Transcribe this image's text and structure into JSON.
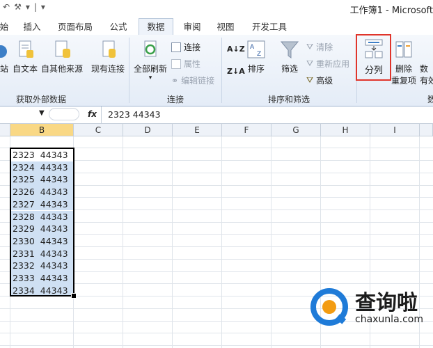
{
  "window": {
    "title": "工作簿1 - Microsoft"
  },
  "tabs": [
    {
      "label": "始"
    },
    {
      "label": "插入"
    },
    {
      "label": "页面布局"
    },
    {
      "label": "公式"
    },
    {
      "label": "数据",
      "active": true
    },
    {
      "label": "审阅"
    },
    {
      "label": "视图"
    },
    {
      "label": "开发工具"
    }
  ],
  "ribbon": {
    "get_external": {
      "web": "站",
      "text": "自文本",
      "other": "自其他来源",
      "existing": "现有连接",
      "group": "获取外部数据"
    },
    "connections": {
      "refresh_all": "全部刷新",
      "connections": "连接",
      "properties": "属性",
      "edit_links": "编辑链接",
      "group": "连接"
    },
    "sort_filter": {
      "sort": "排序",
      "filter": "筛选",
      "clear": "清除",
      "reapply": "重新应用",
      "advanced": "高级",
      "group": "排序和筛选"
    },
    "data_tools": {
      "text_to_columns": "分列",
      "remove_dup_line1": "删除",
      "remove_dup_line2": "重复项",
      "validation_line1": "数",
      "validation_line2": "有效",
      "group": "数"
    }
  },
  "formula_bar": {
    "fx": "fx",
    "content": "2323  44343"
  },
  "columns": [
    "B",
    "C",
    "D",
    "E",
    "F",
    "G",
    "H",
    "I"
  ],
  "cells": [
    "2323  44343",
    "2324  44343",
    "2325  44343",
    "2326  44343",
    "2327  44343",
    "2328  44343",
    "2329  44343",
    "2330  44343",
    "2331  44343",
    "2332  44343",
    "2333  44343",
    "2334  44343"
  ],
  "watermark": {
    "brand": "查询啦",
    "url": "chaxunla.com"
  },
  "colors": {
    "highlight": "#e0352b",
    "selection": "#cfe0f3",
    "ribbon": "#e4ecf7",
    "selected_header": "#f9d885"
  }
}
